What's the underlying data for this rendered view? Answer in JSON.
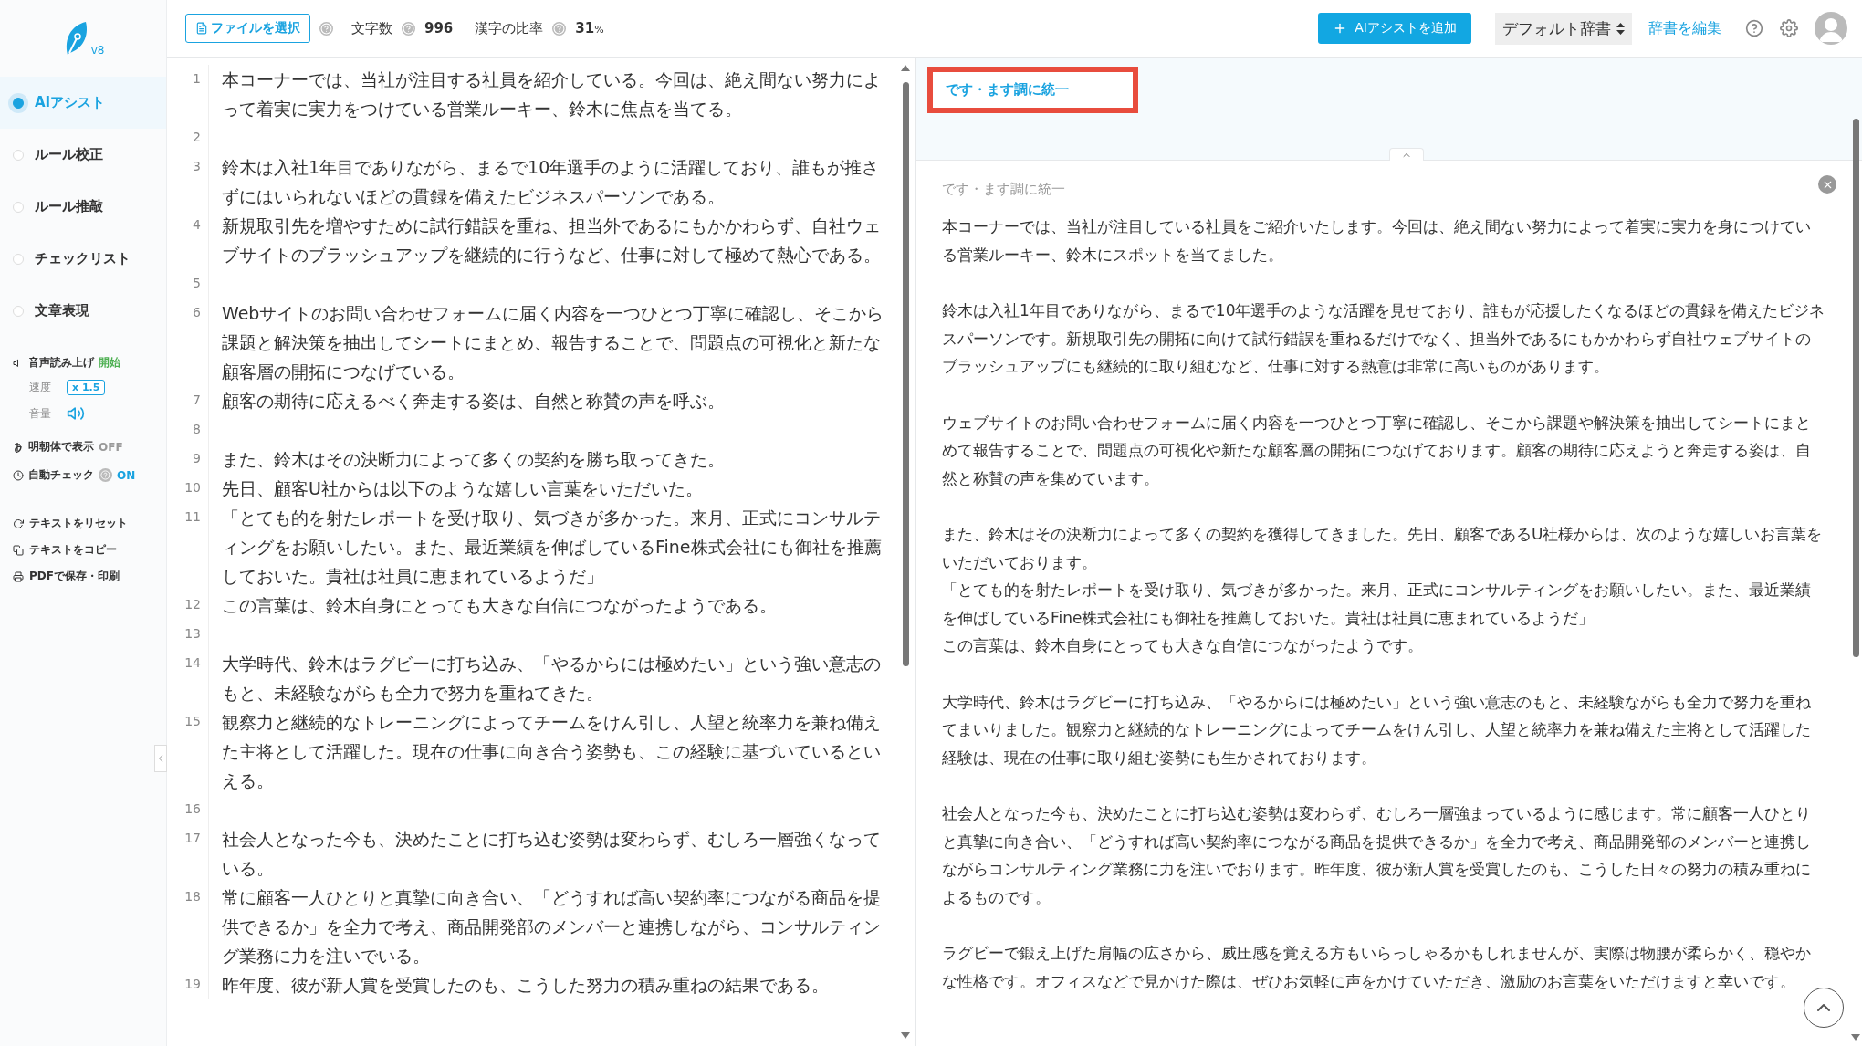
{
  "sidebar": {
    "version": "v8",
    "modes": [
      {
        "label": "AIアシスト",
        "selected": true
      },
      {
        "label": "ルール校正",
        "selected": false
      },
      {
        "label": "ルール推敲",
        "selected": false
      },
      {
        "label": "チェックリスト",
        "selected": false
      },
      {
        "label": "文章表現",
        "selected": false
      }
    ],
    "speech": {
      "label": "音声読み上げ",
      "action": "開始",
      "speed_label": "速度",
      "speed": "x 1.5",
      "volume_label": "音量"
    },
    "toggles": [
      {
        "kind": "font",
        "label": "明朝体で表示",
        "on": false,
        "value": "OFF",
        "help": false
      },
      {
        "kind": "timer",
        "label": "自動チェック",
        "on": true,
        "value": "ON",
        "help": true
      }
    ],
    "actions": [
      {
        "kind": "reset",
        "label": "テキストをリセット"
      },
      {
        "kind": "copy",
        "label": "テキストをコピー"
      },
      {
        "kind": "print",
        "label": "PDFで保存・印刷"
      }
    ]
  },
  "toolbar": {
    "file_button": "ファイルを選択",
    "char_count_label": "文字数",
    "char_count": "996",
    "kanji_label": "漢字の比率",
    "kanji_ratio": "31",
    "kanji_unit": "%",
    "add_button": "AIアシストを追加",
    "dictionary": "デフォルト辞書",
    "edit_dictionary": "辞書を編集"
  },
  "editor": {
    "lines": [
      {
        "number": "1",
        "text": "本コーナーでは、当社が注目する社員を紹介している。今回は、絶え間ない努力によって着実に実力をつけている営業ルーキー、鈴木に焦点を当てる。"
      },
      {
        "number": "2"
      },
      {
        "number": "3",
        "text": "鈴木は入社1年目でありながら、まるで10年選手のように活躍しており、誰もが推さずにはいられないほどの貫録を備えたビジネスパーソンである。"
      },
      {
        "number": "4",
        "text": "新規取引先を増やすために試行錯誤を重ね、担当外であるにもかかわらず、自社ウェブサイトのブラッシュアップを継続的に行うなど、仕事に対して極めて熱心である。"
      },
      {
        "number": "5"
      },
      {
        "number": "6",
        "text": "Webサイトのお問い合わせフォームに届く内容を一つひとつ丁寧に確認し、そこから課題と解決策を抽出してシートにまとめ、報告することで、問題点の可視化と新たな顧客層の開拓につなげている。"
      },
      {
        "number": "7",
        "text": "顧客の期待に応えるべく奔走する姿は、自然と称賛の声を呼ぶ。"
      },
      {
        "number": "8"
      },
      {
        "number": "9",
        "text": "また、鈴木はその決断力によって多くの契約を勝ち取ってきた。"
      },
      {
        "number": "10",
        "text": "先日、顧客U社からは以下のような嬉しい言葉をいただいた。"
      },
      {
        "number": "11",
        "text": "「とても的を射たレポートを受け取り、気づきが多かった。来月、正式にコンサルティングをお願いしたい。また、最近業績を伸ばしているFine株式会社にも御社を推薦しておいた。貴社は社員に恵まれているようだ」"
      },
      {
        "number": "12",
        "text": "この言葉は、鈴木自身にとっても大きな自信につながったようである。"
      },
      {
        "number": "13"
      },
      {
        "number": "14",
        "text": "大学時代、鈴木はラグビーに打ち込み、「やるからには極めたい」という強い意志のもと、未経験ながらも全力で努力を重ねてきた。"
      },
      {
        "number": "15",
        "text": "観察力と継続的なトレーニングによってチームをけん引し、人望と統率力を兼ね備えた主将として活躍した。現在の仕事に向き合う姿勢も、この経験に基づいているといえる。"
      },
      {
        "number": "16"
      },
      {
        "number": "17",
        "text": "社会人となった今も、決めたことに打ち込む姿勢は変わらず、むしろ一層強くなっている。"
      },
      {
        "number": "18",
        "text": "常に顧客一人ひとりと真摯に向き合い、「どうすれば高い契約率につながる商品を提供できるか」を全力で考え、商品開発部のメンバーと連携しながら、コンサルティング業務に力を注いでいる。"
      },
      {
        "number": "19",
        "text": "昨年度、彼が新人賞を受賞したのも、こうした努力の積み重ねの結果である。"
      }
    ]
  },
  "assist": {
    "tabs": [
      {
        "label": "です・ます調に統一",
        "selected": true
      }
    ],
    "result_title": "です・ます調に統一",
    "paragraphs": [
      [
        "本コーナーでは、当社が注目している社員をご紹介いたします。今回は、絶え間ない努力によって着実に実力を身につけている営業ルーキー、鈴木にスポットを当てました。"
      ],
      [
        "鈴木は入社1年目でありながら、まるで10年選手のような活躍を見せており、誰もが応援したくなるほどの貫録を備えたビジネスパーソンです。新規取引先の開拓に向けて試行錯誤を重ねるだけでなく、担当外であるにもかかわらず自社ウェブサイトのブラッシュアップにも継続的に取り組むなど、仕事に対する熱意は非常に高いものがあります。"
      ],
      [
        "ウェブサイトのお問い合わせフォームに届く内容を一つひとつ丁寧に確認し、そこから課題や解決策を抽出してシートにまとめて報告することで、問題点の可視化や新たな顧客層の開拓につなげております。顧客の期待に応えようと奔走する姿は、自然と称賛の声を集めています。"
      ],
      [
        "また、鈴木はその決断力によって多くの契約を獲得してきました。先日、顧客であるU社様からは、次のような嬉しいお言葉をいただいております。",
        "「とても的を射たレポートを受け取り、気づきが多かった。来月、正式にコンサルティングをお願いしたい。また、最近業績を伸ばしているFine株式会社にも御社を推薦しておいた。貴社は社員に恵まれているようだ」",
        "この言葉は、鈴木自身にとっても大きな自信につながったようです。"
      ],
      [
        "大学時代、鈴木はラグビーに打ち込み、「やるからには極めたい」という強い意志のもと、未経験ながらも全力で努力を重ねてまいりました。観察力と継続的なトレーニングによってチームをけん引し、人望と統率力を兼ね備えた主将として活躍した経験は、現在の仕事に取り組む姿勢にも生かされております。"
      ],
      [
        "社会人となった今も、決めたことに打ち込む姿勢は変わらず、むしろ一層強まっているように感じます。常に顧客一人ひとりと真摯に向き合い、「どうすれば高い契約率につながる商品を提供できるか」を全力で考え、商品開発部のメンバーと連携しながらコンサルティング業務に力を注いでおります。昨年度、彼が新人賞を受賞したのも、こうした日々の努力の積み重ねによるものです。"
      ],
      [
        "ラグビーで鍛え上げた肩幅の広さから、威圧感を覚える方もいらっしゃるかもしれませんが、実際は物腰が柔らかく、穏やかな性格です。オフィスなどで見かけた際は、ぜひお気軽に声をかけていただき、激励のお言葉をいただけますと幸いです。"
      ]
    ]
  }
}
